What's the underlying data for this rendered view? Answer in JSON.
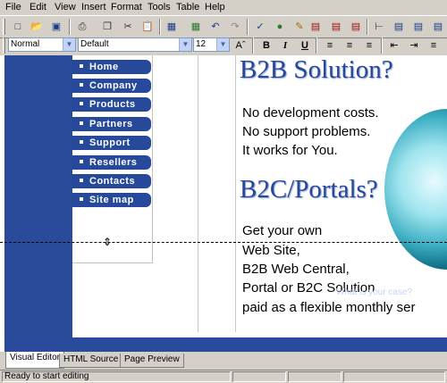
{
  "menu": [
    "File",
    "Edit",
    "View",
    "Insert",
    "Format",
    "Tools",
    "Table",
    "Help"
  ],
  "toolbar": {
    "buttons": [
      "new-icon",
      "open-icon",
      "save-icon",
      "print-icon",
      "copy-icon",
      "cut-icon",
      "paste-icon",
      "insert-table-icon",
      "insert-image-icon",
      "undo-icon",
      "redo-icon",
      "spellcheck-icon",
      "insert-object-icon",
      "paint-icon",
      "table-icon",
      "table-row-icon",
      "table-col-icon"
    ]
  },
  "format": {
    "style_value": "Normal",
    "font_value": "Default",
    "size_value": "12",
    "bold": "B",
    "italic": "I",
    "underline": "U"
  },
  "page": {
    "nav": [
      "Home",
      "Company",
      "Products",
      "Partners",
      "Support",
      "Resellers",
      "Contacts",
      "Site map"
    ],
    "headline1": "B2B Solution?",
    "lines1": [
      "No development costs.",
      "No support problems.",
      "It works for You."
    ],
    "headline2": "B2C/Portals?",
    "lines2": [
      "Get your own",
      "Web Site,",
      "B2B Web Central,",
      "Portal or B2C Solution",
      "paid as a flexible monthly ser"
    ],
    "footer_text": "What is your case?"
  },
  "tabs": [
    "Visual Editor",
    "HTML Source",
    "Page Preview"
  ],
  "status": "Ready to start editing",
  "colors": {
    "brand_blue": "#2a4b9c",
    "headline": "#27479a"
  }
}
